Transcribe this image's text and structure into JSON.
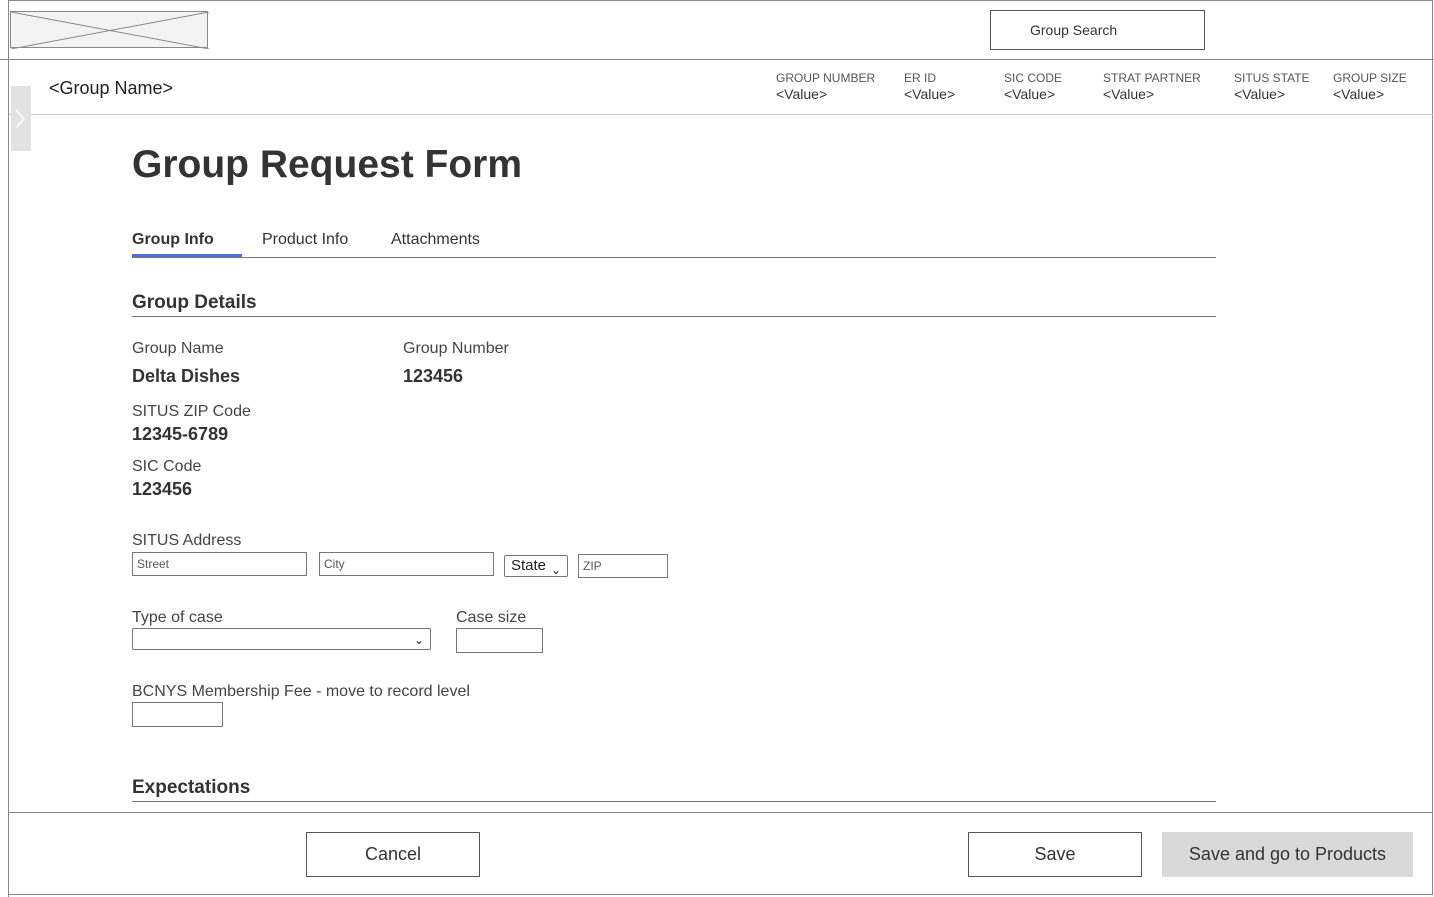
{
  "header": {
    "logo_icon": "image-placeholder-icon",
    "search_label": "Group Search"
  },
  "group_bar": {
    "group_name": "<Group Name>",
    "fields": [
      {
        "label": "GROUP NUMBER",
        "value": "<Value>"
      },
      {
        "label": "ER ID",
        "value": "<Value>"
      },
      {
        "label": "SIC CODE",
        "value": "<Value>"
      },
      {
        "label": "STRAT PARTNER",
        "value": "<Value>"
      },
      {
        "label": "SITUS STATE",
        "value": "<Value>"
      },
      {
        "label": "GROUP SIZE",
        "value": "<Value>"
      }
    ]
  },
  "page": {
    "title": "Group Request Form",
    "tabs": [
      {
        "label": "Group Info",
        "active": true
      },
      {
        "label": "Product Info",
        "active": false
      },
      {
        "label": "Attachments",
        "active": false
      }
    ]
  },
  "group_details": {
    "heading": "Group Details",
    "group_name_label": "Group Name",
    "group_name_value": "Delta Dishes",
    "group_number_label": "Group Number",
    "group_number_value": "123456",
    "situs_zip_label": "SITUS ZIP Code",
    "situs_zip_value": "12345-6789",
    "sic_code_label": "SIC Code",
    "sic_code_value": "123456",
    "situs_address_label": "SITUS Address",
    "street_placeholder": "Street",
    "city_placeholder": "City",
    "state_value": "State",
    "zip_placeholder": "ZIP",
    "type_of_case_label": "Type of case",
    "type_of_case_value": "",
    "case_size_label": "Case size",
    "case_size_value": "",
    "bcnys_label": "BCNYS Membership Fee - move to record level",
    "bcnys_value": ""
  },
  "expectations": {
    "heading": "Expectations"
  },
  "footer": {
    "cancel_label": "Cancel",
    "save_label": "Save",
    "save_products_label": "Save and go to Products"
  }
}
